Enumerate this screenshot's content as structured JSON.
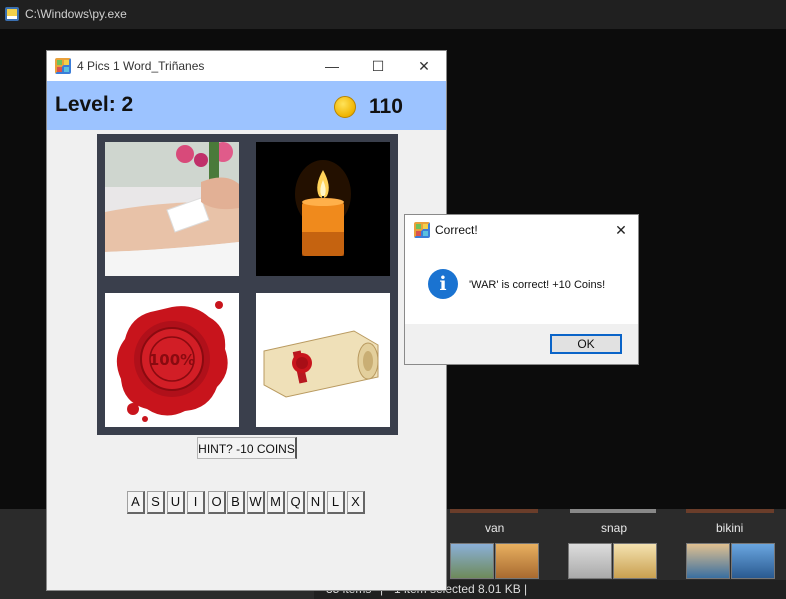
{
  "console": {
    "title": "C:\\Windows\\py.exe"
  },
  "explorer": {
    "labels": [
      "van",
      "snap",
      "bikini"
    ],
    "status": {
      "items": "35 items",
      "selected": "1 item selected  8.01 KB"
    }
  },
  "game": {
    "window_title": "4 Pics 1 Word_Triñanes",
    "level": "Level: 2",
    "coins": "110",
    "pictures": [
      "waxing-strip-image",
      "candle-image",
      "wax-seal-image",
      "sealed-scroll-image"
    ],
    "hint_label": "HINT? -10 COINS",
    "letters": [
      "A",
      "S",
      "U",
      "I",
      "O",
      "B",
      "W",
      "M",
      "Q",
      "N",
      "L",
      "X"
    ]
  },
  "dialog": {
    "title": "Correct!",
    "message": "'WAR' is correct! +10 Coins!",
    "ok_label": "OK"
  },
  "colors": {
    "header": "#9cc3ff",
    "accent": "#0a64c8",
    "info": "#1a73d1"
  }
}
